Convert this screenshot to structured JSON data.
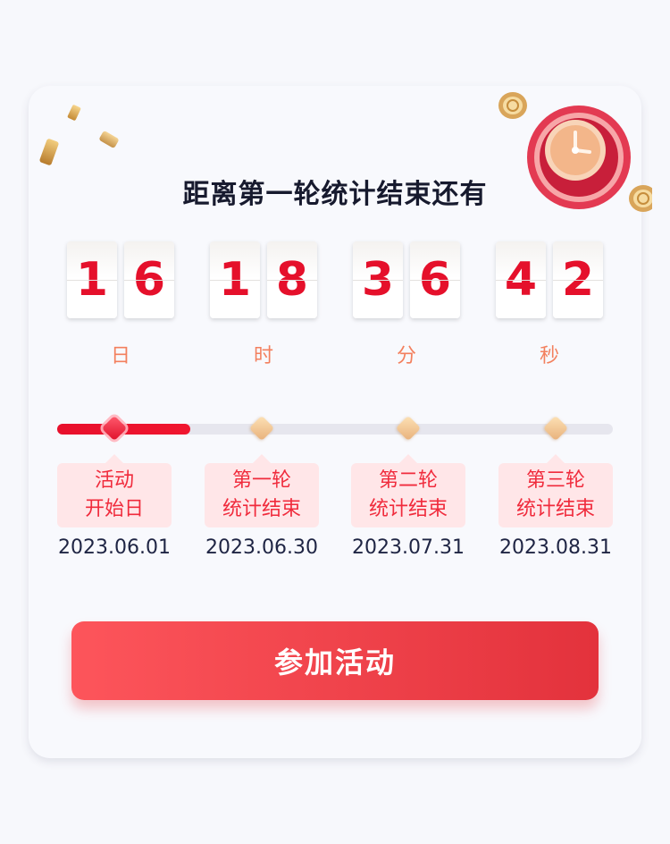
{
  "countdown": {
    "title": "距离第一轮统计结束还有",
    "groups": [
      {
        "digits": [
          "1",
          "6"
        ],
        "unit": "日"
      },
      {
        "digits": [
          "1",
          "8"
        ],
        "unit": "时"
      },
      {
        "digits": [
          "3",
          "6"
        ],
        "unit": "分"
      },
      {
        "digits": [
          "4",
          "2"
        ],
        "unit": "秒"
      }
    ]
  },
  "timeline": {
    "progress_percent": 24,
    "milestones": [
      {
        "line1": "活动",
        "line2": "开始日",
        "date": "2023.06.01",
        "active": true
      },
      {
        "line1": "第一轮",
        "line2": "统计结束",
        "date": "2023.06.30",
        "active": false
      },
      {
        "line1": "第二轮",
        "line2": "统计结束",
        "date": "2023.07.31",
        "active": false
      },
      {
        "line1": "第三轮",
        "line2": "统计结束",
        "date": "2023.08.31",
        "active": false
      }
    ]
  },
  "action": {
    "join_label": "参加活动"
  },
  "colors": {
    "accent": "#e5102b",
    "button_start": "#fd555b",
    "button_end": "#e3323c",
    "unit_text": "#f3805e"
  },
  "icons": [
    "alarm-clock-icon",
    "gold-coin-icon",
    "confetti-icon"
  ]
}
